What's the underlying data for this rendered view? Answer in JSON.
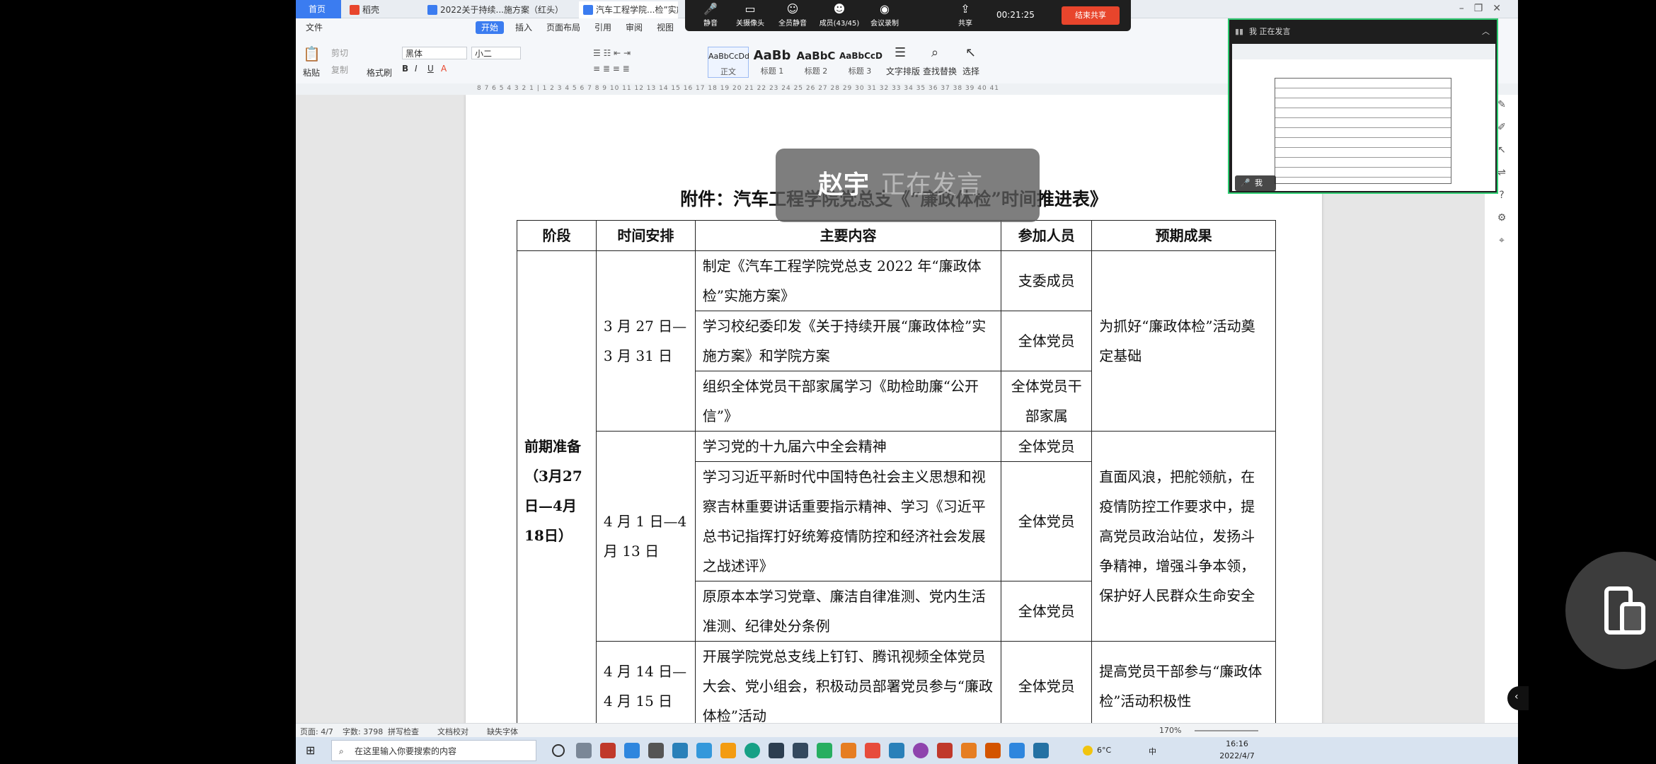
{
  "tabs": [
    {
      "label": "首页"
    },
    {
      "label": "稻壳"
    },
    {
      "label": "2022关于持续...施方案（红头）"
    },
    {
      "label": "汽车工程学院...检”实施"
    }
  ],
  "menu": [
    "文件",
    "开始",
    "插入",
    "页面布局",
    "引用",
    "审阅",
    "视图"
  ],
  "ribbon": {
    "paste": "粘贴",
    "cut": "剪切",
    "copy": "复制",
    "format_painter": "格式刷",
    "font_name": "黑体",
    "font_size": "小二",
    "styles": [
      {
        "preview": "AaBbCcDd",
        "name": "正文"
      },
      {
        "preview": "AaBb",
        "name": "标题 1"
      },
      {
        "preview": "AaBbC",
        "name": "标题 2"
      },
      {
        "preview": "AaBbCcD",
        "name": "标题 3"
      }
    ],
    "text_layout": "文字排版",
    "find_replace": "查找替换",
    "select": "选择"
  },
  "ruler_text": "8  7  6  5  4  3  2  1  |  1  2  3  4  5  6  7  8  9  10  11  12  13  14  15  16  17  18  19  20  21  22  23  24  25  26  27  28  29  30  31  32  33  34  35  36  37  38  39  40  41",
  "document": {
    "title": "附件：汽车工程学院党总支《“廉政体检”时间推进表》",
    "headers": [
      "阶段",
      "时间安排",
      "主要内容",
      "参加人员",
      "预期成果"
    ],
    "phase": "前期准备（3月27日—4月18日）",
    "time1": "3 月 27 日—3 月 31 日",
    "time2": "4 月 1 日—4 月 13 日",
    "time3": "4 月 14 日—4 月 15 日",
    "r1_content": "制定《汽车工程学院党总支 2022 年“廉政体检”实施方案》",
    "r1_people": "支委成员",
    "r2_content": "学习校纪委印发《关于持续开展“廉政体检”实施方案》和学院方案",
    "r2_people": "全体党员",
    "r3_content": "组织全体党员干部家属学习《助检助廉“公开信”》",
    "r3_people": "全体党员干部家属",
    "result1": "为抓好“廉政体检”活动奠定基础",
    "r4_content": "学习党的十九届六中全会精神",
    "r4_people": "全体党员",
    "r5_content": "学习习近平新时代中国特色社会主义思想和视察吉林重要讲话重要指示精神、学习《习近平总书记指挥打好统筹疫情防控和经济社会发展之战述评》",
    "r5_people": "全体党员",
    "r6_content": "原原本本学习党章、廉洁自律准测、党内生活准测、纪律处分条例",
    "r6_people": "全体党员",
    "result2": "直面风浪，把舵领航，在疫情防控工作要求中，提高党员政治站位，发扬斗争精神，增强斗争本领，保护好人民群众生命安全",
    "r7_content": "开展学院党总支线上钉钉、腾讯视频全体党员大会、党小组会，积极动员部署党员参与“廉政体检”活动",
    "r7_people": "全体党员",
    "result3": "提高党员干部参与“廉政体检”活动积极性"
  },
  "status": {
    "page": "页面: 4/7",
    "words": "字数: 3798",
    "spell": "拼写检查",
    "proof": "文档校对",
    "missing_font": "缺失字体",
    "zoom": "170%"
  },
  "taskbar": {
    "search_placeholder": "在这里输入你要搜索的内容",
    "weather": "6°C",
    "ime": "中",
    "time": "16:16",
    "date": "2022/4/7"
  },
  "meeting": {
    "mute": "静音",
    "camera": "关摄像头",
    "mute_all": "全员静音",
    "members": "成员(43/45)",
    "record": "会议录制",
    "share": "共享",
    "timer": "00:21:25",
    "stop_share": "结束共享",
    "speaker_name": "赵宇",
    "speaking_status": "正在发言",
    "thumb_label": "我  正在发言",
    "me": "我"
  },
  "colors": {
    "accent": "#3b7cf0",
    "stop": "#e8452c",
    "active_border": "#2ecc71"
  }
}
